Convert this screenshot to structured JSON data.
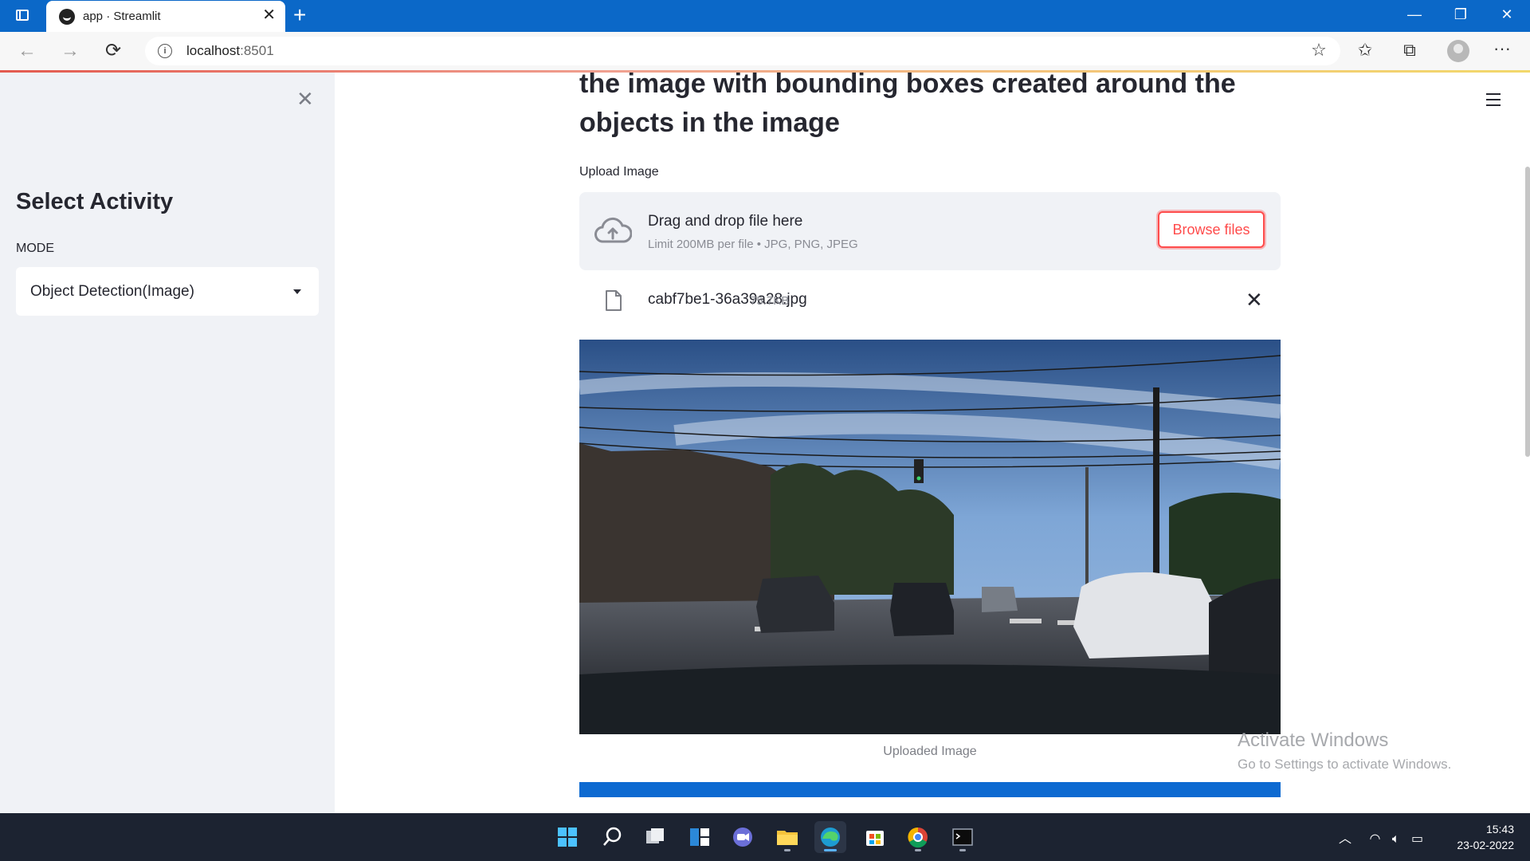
{
  "browser": {
    "tab_title": "app · Streamlit",
    "tab_close_glyph": "✕",
    "new_tab_glyph": "+",
    "url_host": "localhost",
    "url_port": ":8501",
    "window_controls": [
      "—",
      "❐",
      "✕"
    ],
    "more_glyph": "···"
  },
  "sidebar": {
    "close_glyph": "✕",
    "heading": "Select Activity",
    "mode_label": "MODE",
    "mode_value": "Object Detection(Image)"
  },
  "main": {
    "heading": "the image with bounding boxes created around the objects in the image",
    "upload_label": "Upload Image",
    "dropzone_title": "Drag and drop file here",
    "dropzone_limit": "Limit 200MB per file • JPG, PNG, JPEG",
    "browse_button": "Browse files",
    "file_name": "cabf7be1-36a39a28.jpg",
    "file_size": "75.7KB",
    "file_remove_glyph": "✕",
    "image_caption": "Uploaded Image",
    "progress": 1.0
  },
  "watermark": {
    "line1": "Activate Windows",
    "line2": "Go to Settings to activate Windows."
  },
  "taskbar": {
    "apps": [
      "windows-start-icon",
      "search-icon",
      "task-view-icon",
      "widgets-icon",
      "teams-chat-icon",
      "file-explorer-icon",
      "edge-icon",
      "microsoft-store-icon",
      "chrome-icon",
      "terminal-icon"
    ],
    "time": "15:43",
    "date": "23-02-2022"
  },
  "colors": {
    "titlebar": "#0b68c8",
    "sidebar_bg": "#f0f2f6",
    "accent": "#ff4b4b",
    "progress": "#0d6ad1",
    "taskbar": "#1c2331"
  }
}
